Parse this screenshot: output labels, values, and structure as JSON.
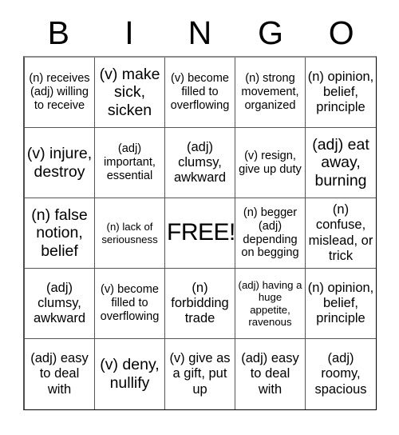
{
  "header": {
    "letters": [
      "B",
      "I",
      "N",
      "G",
      "O"
    ]
  },
  "grid": {
    "columns": 5,
    "rows": 5,
    "free_space_label": "FREE!",
    "free_space_index": 12,
    "cells": [
      {
        "text": "(n) receives (adj) willing to receive",
        "size": "s-sm"
      },
      {
        "text": "(v) make sick, sicken",
        "size": "s-lg"
      },
      {
        "text": "(v) become filled to overflowing",
        "size": "s-sm"
      },
      {
        "text": "(n) strong movement, organized",
        "size": "s-sm"
      },
      {
        "text": "(n) opinion, belief, principle",
        "size": "s-md"
      },
      {
        "text": "(v) injure, destroy",
        "size": "s-lg"
      },
      {
        "text": "(adj) important, essential",
        "size": "s-sm"
      },
      {
        "text": "(adj) clumsy, awkward",
        "size": "s-md"
      },
      {
        "text": "(v) resign, give up duty",
        "size": "s-sm"
      },
      {
        "text": "(adj) eat away, burning",
        "size": "s-lg"
      },
      {
        "text": "(n) false notion, belief",
        "size": "s-lg"
      },
      {
        "text": "(n) lack of seriousness",
        "size": "s-xs"
      },
      {
        "text": "FREE!",
        "size": "s-xl"
      },
      {
        "text": "(n) begger (adj) depending on begging",
        "size": "s-sm"
      },
      {
        "text": "(n) confuse, mislead, or trick",
        "size": "s-md"
      },
      {
        "text": "(adj) clumsy, awkward",
        "size": "s-md"
      },
      {
        "text": "(v) become filled to overflowing",
        "size": "s-sm"
      },
      {
        "text": "(n) forbidding trade",
        "size": "s-md"
      },
      {
        "text": "(adj) having a huge appetite, ravenous",
        "size": "s-xs"
      },
      {
        "text": "(n) opinion, belief, principle",
        "size": "s-md"
      },
      {
        "text": "(adj) easy to deal with",
        "size": "s-md"
      },
      {
        "text": "(v) deny, nullify",
        "size": "s-lg"
      },
      {
        "text": "(v) give as a gift, put up",
        "size": "s-md"
      },
      {
        "text": "(adj) easy to deal with",
        "size": "s-md"
      },
      {
        "text": "(adj) roomy, spacious",
        "size": "s-md"
      }
    ]
  },
  "colors": {
    "background": "#ffffff",
    "text": "#000000",
    "grid_line": "#555555"
  }
}
